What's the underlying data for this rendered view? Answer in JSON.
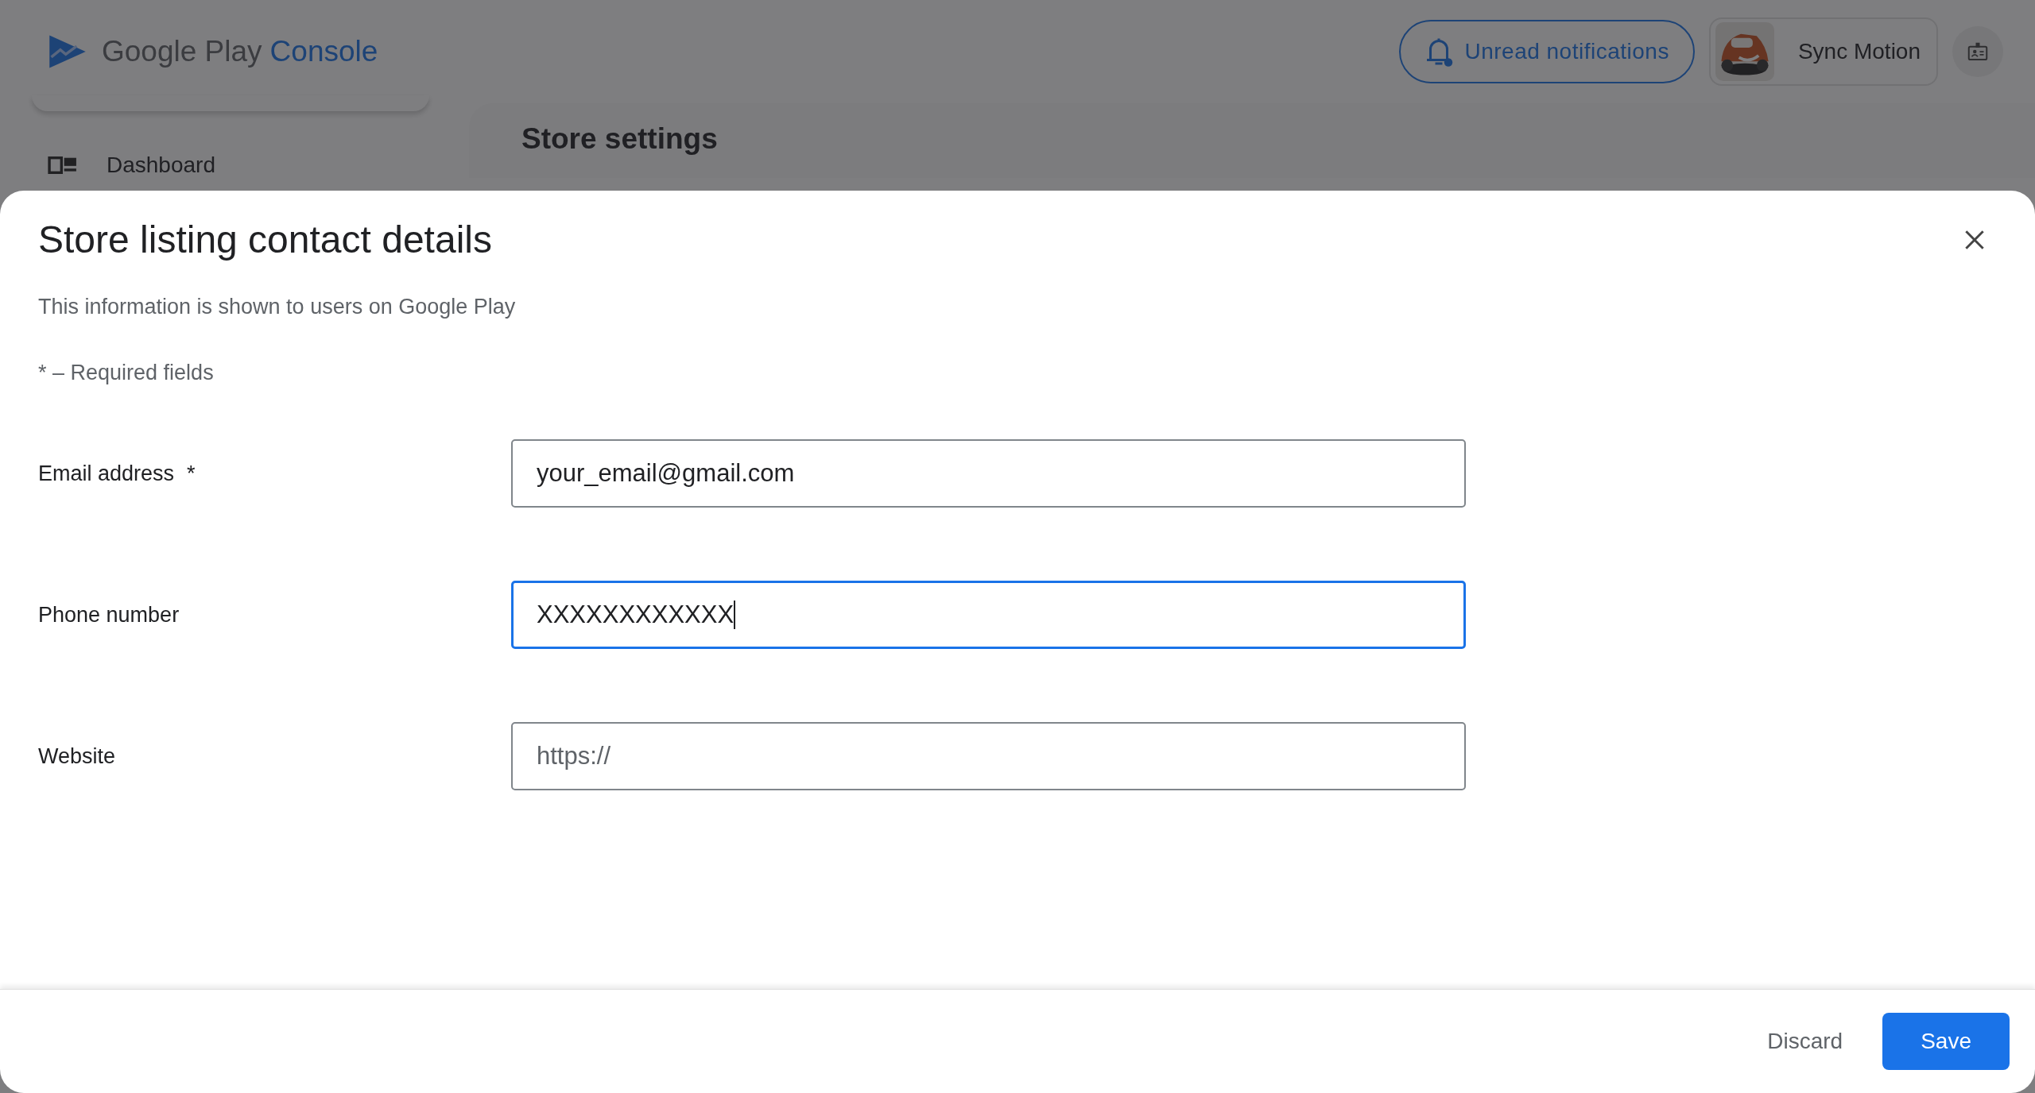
{
  "header": {
    "logo": {
      "brand": "Google Play",
      "product": "Console"
    },
    "notifications_button": "Unread notifications",
    "account": {
      "name": "Sync Motion"
    }
  },
  "sidebar": {
    "items": [
      {
        "label": "Dashboard"
      }
    ]
  },
  "page": {
    "title": "Store settings"
  },
  "dialog": {
    "title": "Store listing contact details",
    "subtitle": "This information is shown to users on Google Play",
    "required_note": "* – Required fields",
    "fields": [
      {
        "label": "Email address",
        "required_mark": "*",
        "value": "your_email@gmail.com",
        "focused": false
      },
      {
        "label": "Phone number",
        "value": "XXXXXXXXXXXX",
        "focused": true
      },
      {
        "label": "Website",
        "placeholder": "https://",
        "focused": false
      }
    ],
    "buttons": [
      {
        "label": "Discard",
        "kind": "text"
      },
      {
        "label": "Save",
        "kind": "primary"
      }
    ]
  }
}
